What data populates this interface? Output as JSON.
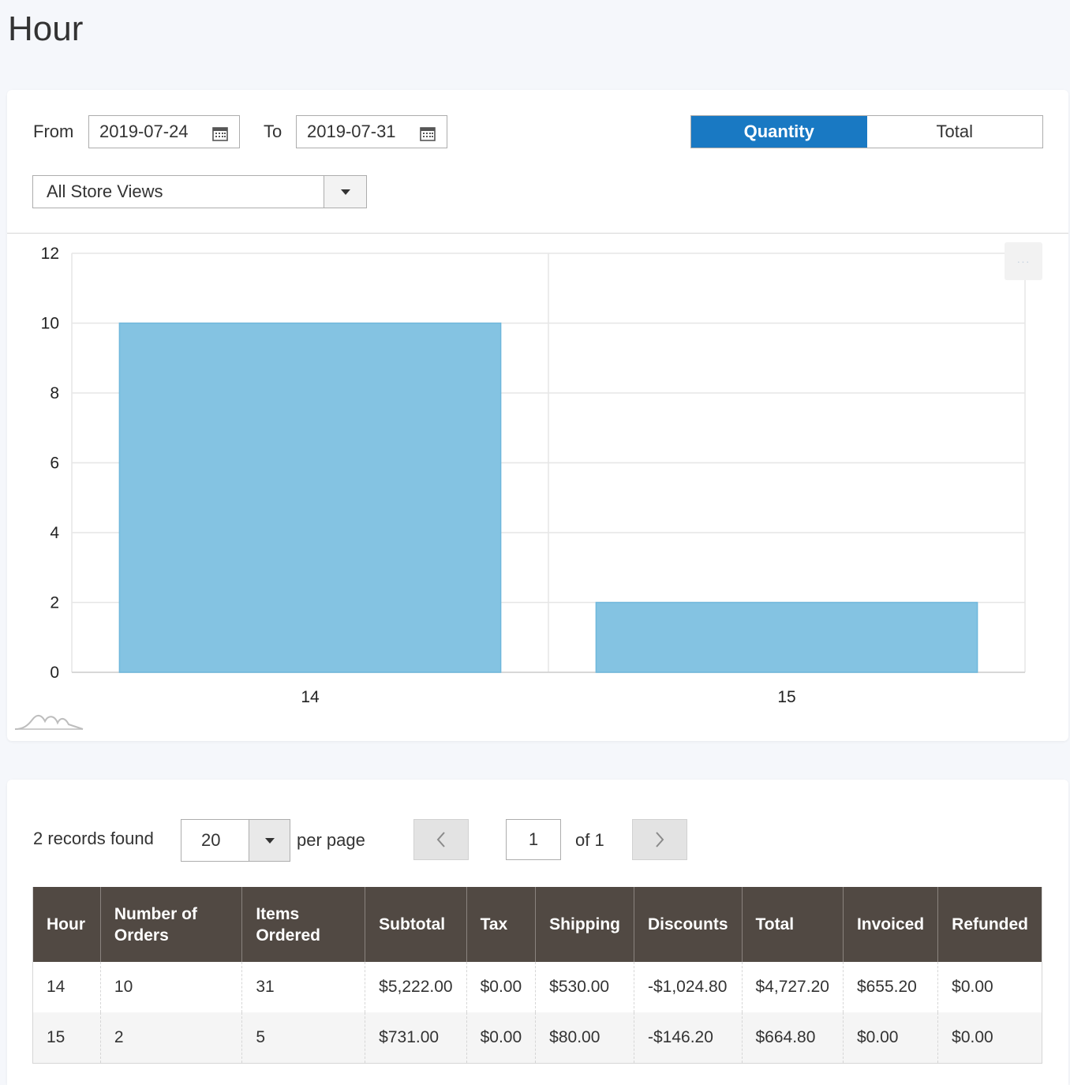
{
  "page": {
    "title": "Hour"
  },
  "filters": {
    "from_label": "From",
    "from_value": "2019-07-24",
    "to_label": "To",
    "to_value": "2019-07-31",
    "store_view": "All Store Views",
    "toggle": {
      "quantity": "Quantity",
      "total": "Total",
      "selected": "Quantity"
    }
  },
  "icons": {
    "calendar": "calendar-icon",
    "menu": "more-dots-icon",
    "logo": "chart-logo-icon",
    "prev": "chevron-left-icon",
    "next": "chevron-right-icon"
  },
  "colors": {
    "accent": "#1979c3",
    "bar": "#84c3e2",
    "header": "#514943"
  },
  "chart_data": {
    "type": "bar",
    "categories": [
      "14",
      "15"
    ],
    "values": [
      10,
      2
    ],
    "y_ticks": [
      0,
      2,
      4,
      6,
      8,
      10,
      12
    ],
    "ylim": [
      0,
      12
    ],
    "grid": true
  },
  "grid": {
    "records_found": "2 records found",
    "per_page_value": "20",
    "per_page_label": "per page",
    "page_value": "1",
    "page_of": "of 1",
    "columns": [
      "Hour",
      "Number of Orders",
      "Items Ordered",
      "Subtotal",
      "Tax",
      "Shipping",
      "Discounts",
      "Total",
      "Invoiced",
      "Refunded"
    ],
    "rows": [
      [
        "14",
        "10",
        "31",
        "$5,222.00",
        "$0.00",
        "$530.00",
        "-$1,024.80",
        "$4,727.20",
        "$655.20",
        "$0.00"
      ],
      [
        "15",
        "2",
        "5",
        "$731.00",
        "$0.00",
        "$80.00",
        "-$146.20",
        "$664.80",
        "$0.00",
        "$0.00"
      ]
    ]
  }
}
